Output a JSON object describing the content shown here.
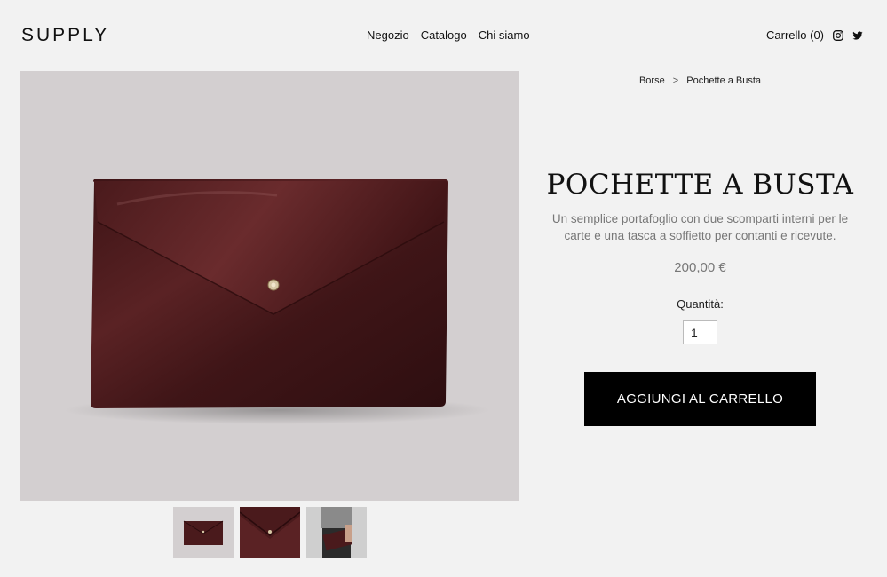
{
  "header": {
    "logo": "SUPPLY",
    "nav": [
      "Negozio",
      "Catalogo",
      "Chi siamo"
    ],
    "cart_label": "Carrello (0)",
    "social_icons": [
      "instagram-icon",
      "twitter-icon"
    ]
  },
  "breadcrumb": {
    "parent": "Borse",
    "separator": ">",
    "current": "Pochette a Busta"
  },
  "product": {
    "title": "POCHETTE A BUSTA",
    "description": "Un semplice portafoglio con due scomparti interni per le carte e una tasca a soffietto per contanti e ricevute.",
    "price": "200,00 €",
    "quantity_label": "Quantità:",
    "quantity_value": "1",
    "add_to_cart_label": "AGGIUNGI AL CARRELLO",
    "image_count": 3
  },
  "colors": {
    "background": "#f2f2f2",
    "image_background": "#d3cfd0",
    "leather": "#4a1a1c",
    "button": "#000000",
    "button_text": "#ffffff",
    "muted_text": "#777777"
  }
}
